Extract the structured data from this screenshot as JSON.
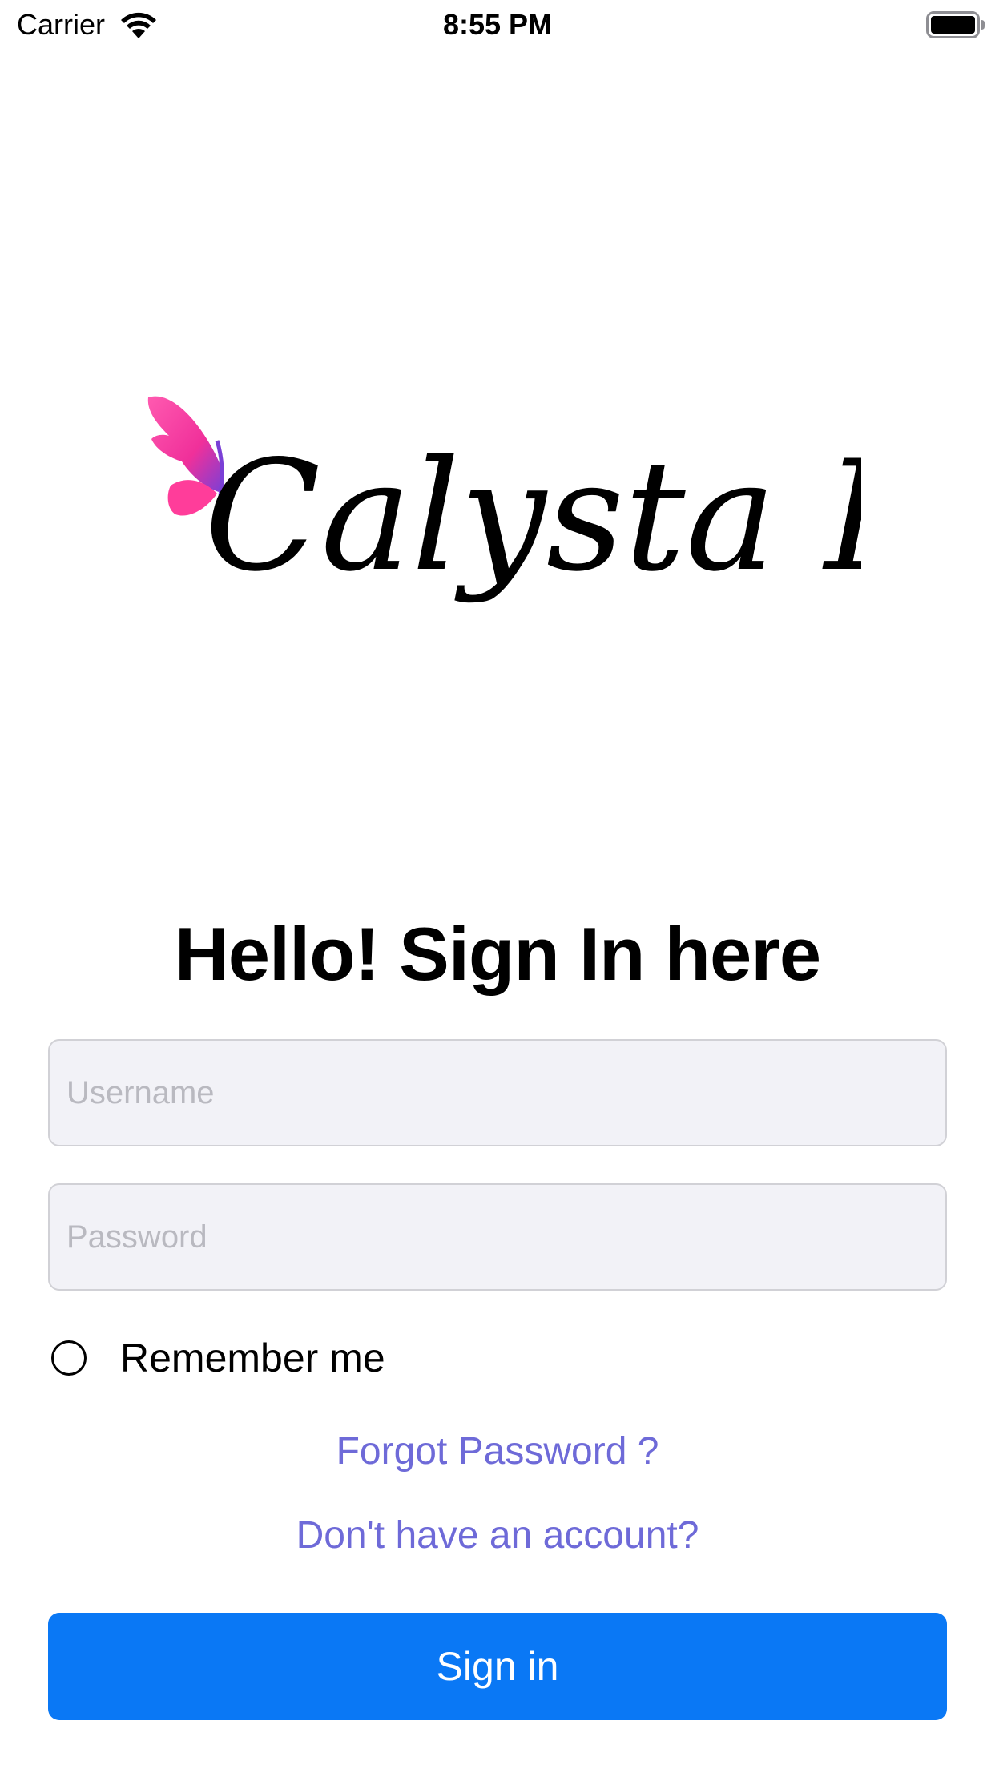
{
  "status_bar": {
    "carrier": "Carrier",
    "time": "8:55 PM",
    "wifi_icon": "wifi-icon",
    "battery_icon": "battery-icon"
  },
  "logo": {
    "text": "Calysta Pro",
    "icon": "butterfly-icon",
    "colors": {
      "wing_pink": "#ff3d9a",
      "wing_purple": "#7a3fd6",
      "text": "#000000"
    }
  },
  "headline": "Hello! Sign In here",
  "form": {
    "username": {
      "value": "",
      "placeholder": "Username"
    },
    "password": {
      "value": "",
      "placeholder": "Password"
    },
    "remember_label": "Remember me",
    "remember_checked": false
  },
  "links": {
    "forgot_password": "Forgot Password ?",
    "sign_up": "Don't have an account?"
  },
  "button": {
    "sign_in": "Sign in"
  },
  "colors": {
    "link": "#6e6ad8",
    "primary": "#0a78f5",
    "field_bg": "#f2f2f7"
  }
}
